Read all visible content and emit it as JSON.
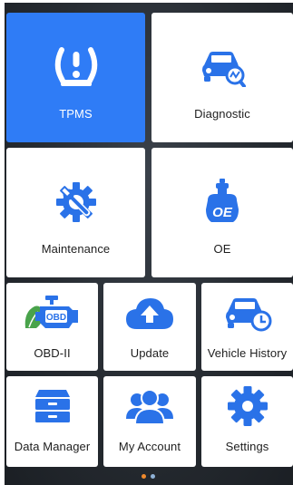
{
  "tiles": {
    "tpms": {
      "label": "TPMS",
      "icon": "tire-pressure-icon"
    },
    "diagnostic": {
      "label": "Diagnostic",
      "icon": "car-diagnostic-icon"
    },
    "maintenance": {
      "label": "Maintenance",
      "icon": "wrench-gear-icon"
    },
    "oe": {
      "label": "OE",
      "icon": "oe-oil-icon"
    },
    "obd2": {
      "label": "OBD-II",
      "icon": "engine-obd-icon"
    },
    "update": {
      "label": "Update",
      "icon": "cloud-upload-icon"
    },
    "vehicle_history": {
      "label": "Vehicle History",
      "icon": "car-history-icon"
    },
    "data_manager": {
      "label": "Data Manager",
      "icon": "file-cabinet-icon"
    },
    "my_account": {
      "label": "My Account",
      "icon": "users-icon"
    },
    "settings": {
      "label": "Settings",
      "icon": "gear-icon"
    }
  },
  "colors": {
    "accent": "#2f7cf6",
    "icon_blue": "#2a72e8",
    "icon_green": "#49a34b",
    "page_dot_active": "#f08a2c",
    "page_dot_inactive": "#8fb2d6"
  },
  "pagination": {
    "active_index": 0,
    "total": 2
  }
}
